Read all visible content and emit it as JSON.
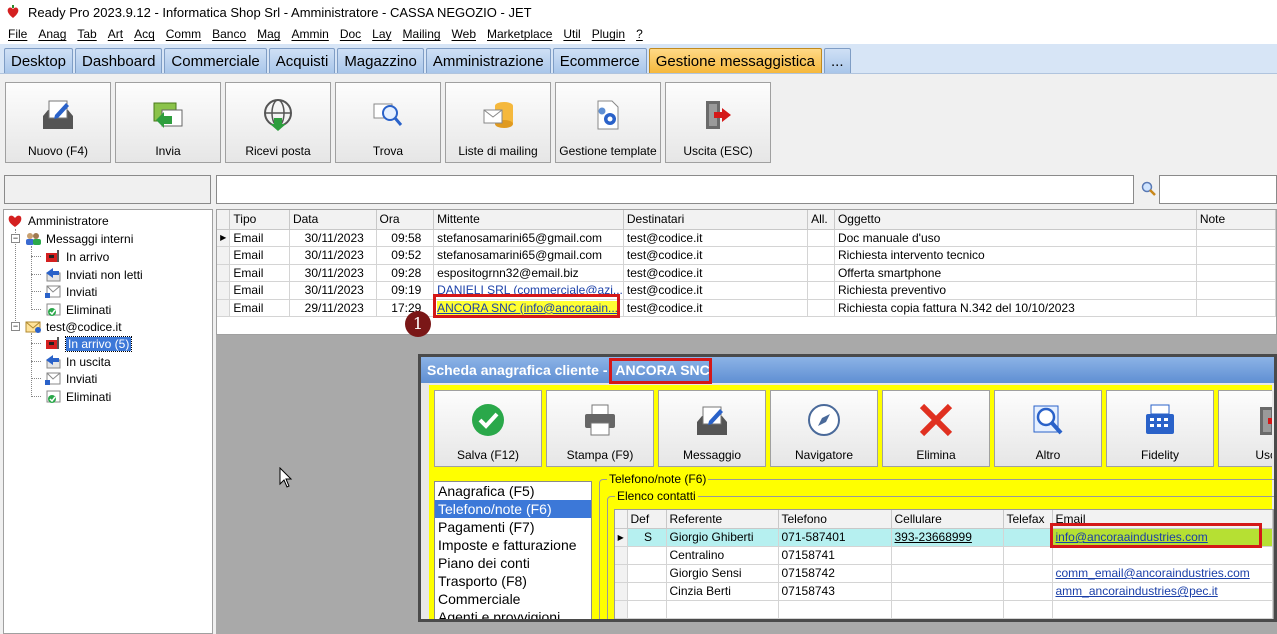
{
  "window": {
    "title": "Ready Pro 2023.9.12 - Informatica Shop Srl - Amministratore - CASSA NEGOZIO - JET"
  },
  "menu": [
    "File",
    "Anag",
    "Tab",
    "Art",
    "Acq",
    "Comm",
    "Banco",
    "Mag",
    "Ammin",
    "Doc",
    "Lay",
    "Mailing",
    "Web",
    "Marketplace",
    "Util",
    "Plugin",
    "?"
  ],
  "tabs": [
    "Desktop",
    "Dashboard",
    "Commerciale",
    "Acquisti",
    "Magazzino",
    "Amministrazione",
    "Ecommerce",
    "Gestione messaggistica",
    "..."
  ],
  "active_tab": "Gestione messaggistica",
  "toolbar": {
    "nuovo": "Nuovo (F4)",
    "invia": "Invia",
    "ricevi": "Ricevi posta",
    "trova": "Trova",
    "liste": "Liste di mailing",
    "template": "Gestione template",
    "uscita": "Uscita (ESC)"
  },
  "tree": {
    "root": "Amministratore",
    "internal": "Messaggi interni",
    "int_items": [
      "In arrivo",
      "Inviati non letti",
      "Inviati",
      "Eliminati"
    ],
    "account": "test@codice.it",
    "acc_items": [
      "In arrivo (5)",
      "In uscita",
      "Inviati",
      "Eliminati"
    ],
    "selected": "In arrivo (5)"
  },
  "messages": {
    "headers": [
      "Tipo",
      "Data",
      "Ora",
      "Mittente",
      "Destinatari",
      "All.",
      "Oggetto",
      "Note"
    ],
    "rows": [
      {
        "tipo": "Email",
        "data": "30/11/2023",
        "ora": "09:58",
        "mittente": "stefanosamarini65@gmail.com",
        "dest": "test@codice.it",
        "all": "",
        "oggetto": "Doc manuale d'uso",
        "note": ""
      },
      {
        "tipo": "Email",
        "data": "30/11/2023",
        "ora": "09:52",
        "mittente": "stefanosamarini65@gmail.com",
        "dest": "test@codice.it",
        "all": "",
        "oggetto": "Richiesta intervento tecnico",
        "note": ""
      },
      {
        "tipo": "Email",
        "data": "30/11/2023",
        "ora": "09:28",
        "mittente": "espositogrnn32@email.biz",
        "dest": "test@codice.it",
        "all": "",
        "oggetto": "Offerta smartphone",
        "note": ""
      },
      {
        "tipo": "Email",
        "data": "30/11/2023",
        "ora": "09:19",
        "mittente": "DANIELI SRL (commerciale@azi...",
        "dest": "test@codice.it",
        "all": "",
        "oggetto": "Richiesta preventivo",
        "note": ""
      },
      {
        "tipo": "Email",
        "data": "29/11/2023",
        "ora": "17:29",
        "mittente": "ANCORA SNC (info@ancoraain...",
        "dest": "test@codice.it",
        "all": "",
        "oggetto": "Richiesta copia fattura N.342 del 10/10/2023",
        "note": ""
      }
    ]
  },
  "callout_number": "1",
  "popup": {
    "title_prefix": "Scheda anagrafica cliente - ",
    "title_name": "ANCORA SNC",
    "buttons": [
      "Salva (F12)",
      "Stampa (F9)",
      "Messaggio",
      "Navigatore",
      "Elimina",
      "Altro",
      "Fidelity",
      "Uscita"
    ],
    "sections": [
      "Anagrafica (F5)",
      "Telefono/note (F6)",
      "Pagamenti (F7)",
      "Imposte e fatturazione",
      "Piano dei conti",
      "Trasporto (F8)",
      "Commerciale",
      "Agenti e provvigioni"
    ],
    "selected_section": "Telefono/note (F6)",
    "group_title": "Telefono/note (F6)",
    "subgroup_title": "Elenco contatti",
    "contacts_headers": [
      "Def",
      "Referente",
      "Telefono",
      "Cellulare",
      "Telefax",
      "Email"
    ],
    "contacts": [
      {
        "def": "S",
        "referente": "Giorgio Ghiberti",
        "telefono": "071-587401",
        "cellulare": "393-23668999",
        "telefax": "",
        "email": "info@ancoraaindustries.com"
      },
      {
        "def": "",
        "referente": "Centralino",
        "telefono": "07158741",
        "cellulare": "",
        "telefax": "",
        "email": ""
      },
      {
        "def": "",
        "referente": "Giorgio Sensi",
        "telefono": "07158742",
        "cellulare": "",
        "telefax": "",
        "email": "comm_email@ancoraindustries.com"
      },
      {
        "def": "",
        "referente": "Cinzia Berti",
        "telefono": "07158743",
        "cellulare": "",
        "telefax": "",
        "email": "amm_ancoraindustries@pec.it"
      }
    ]
  },
  "colors": {
    "accent_tab": "#f5b83c",
    "popup_bg": "#ffff00",
    "highlight": "#d41818",
    "selection": "#3c78d8"
  }
}
